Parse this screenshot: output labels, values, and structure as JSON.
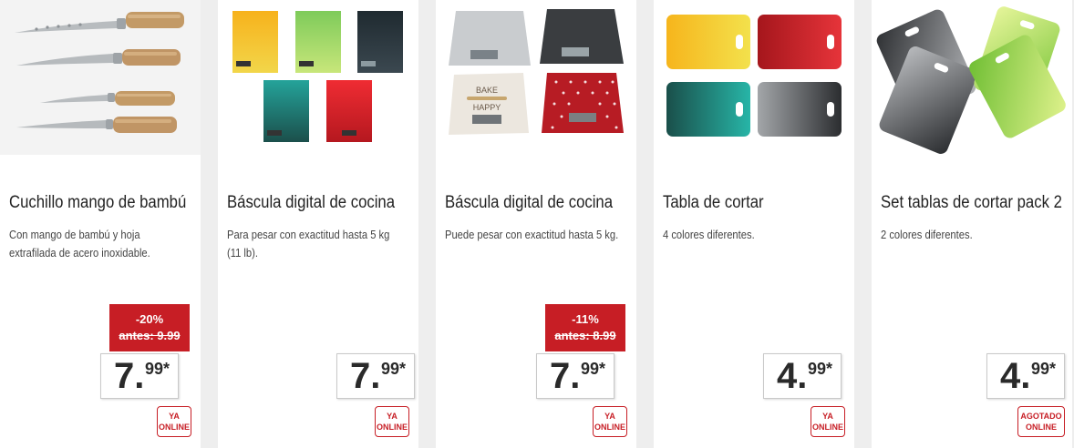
{
  "products": [
    {
      "image": "knives-icon",
      "title": "Cuchillo mango de bambú",
      "description": "Con mango de bambú y hoja extrafilada de acero inoxidable.",
      "discount": {
        "percent": "-20%",
        "old_price": "antes: 9.99"
      },
      "price": {
        "integer": "7.",
        "decimal": "99*"
      },
      "availability": {
        "line1": "YA",
        "line2": "ONLINE"
      }
    },
    {
      "image": "kitchen-scales-gradient-icon",
      "title": "Báscula digital de cocina",
      "description": "Para pesar con exactitud hasta 5 kg (11 lb).",
      "discount": null,
      "price": {
        "integer": "7.",
        "decimal": "99*"
      },
      "availability": {
        "line1": "YA",
        "line2": "ONLINE"
      }
    },
    {
      "image": "kitchen-scales-print-icon",
      "title": "Báscula digital de cocina",
      "description": "Puede pesar con exactitud hasta 5 kg.",
      "discount": {
        "percent": "-11%",
        "old_price": "antes: 8.99"
      },
      "price": {
        "integer": "7.",
        "decimal": "99*"
      },
      "availability": {
        "line1": "YA",
        "line2": "ONLINE"
      }
    },
    {
      "image": "cutting-boards-icon",
      "title": "Tabla de cortar",
      "description": "4 colores diferentes.",
      "discount": null,
      "price": {
        "integer": "4.",
        "decimal": "99*"
      },
      "availability": {
        "line1": "YA",
        "line2": "ONLINE"
      }
    },
    {
      "image": "cutting-boards-pack-icon",
      "title": "Set tablas de cortar pack 2",
      "description": "2 colores diferentes.",
      "discount": null,
      "price": {
        "integer": "4.",
        "decimal": "99*"
      },
      "availability": {
        "line1": "AGOTADO",
        "line2": "ONLINE"
      }
    }
  ],
  "colors": {
    "discount_red": "#c71e25",
    "background": "#eeeeee",
    "card": "#ffffff"
  }
}
